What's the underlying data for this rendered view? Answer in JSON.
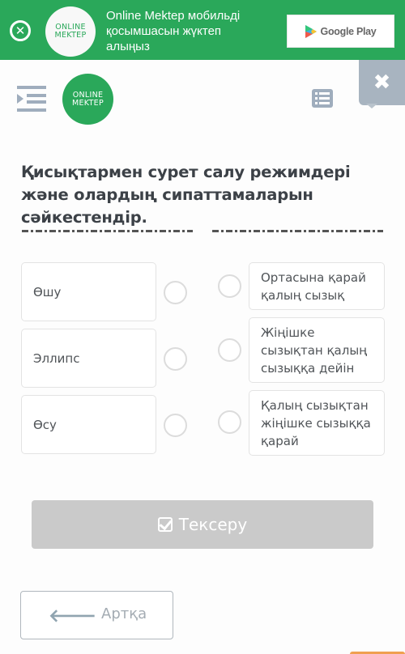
{
  "banner": {
    "close_icon": "circle-x-icon",
    "logo": {
      "line1": "ONLINE",
      "line2": "MEKTEP"
    },
    "message": "Online Mektep мобильді қосымшасын жүктеп алыңыз",
    "store_button": {
      "label": "Google Play",
      "icon": "google-play-icon"
    }
  },
  "header": {
    "menu_icon": "sidebar-toggle-icon",
    "logo": {
      "line1": "ONLINE",
      "line2": "MEKTEP"
    },
    "list_icon": "list-icon",
    "close_icon": "close-icon"
  },
  "task": {
    "title": "Қисықтармен сурет салу режимдері және олардың сипаттамаларын сәйкестендір."
  },
  "matching": {
    "left": [
      {
        "label": "Өшу"
      },
      {
        "label": "Эллипс"
      },
      {
        "label": "Өсу"
      }
    ],
    "right": [
      {
        "label": "Ортасына қарай қалың сызық"
      },
      {
        "label": "Жіңішке сызықтан қалың сызыққа дейін"
      },
      {
        "label": "Қалың сызықтан жіңішке сызыққа қарай"
      }
    ]
  },
  "actions": {
    "check_label": "Тексеру",
    "check_icon": "checkbox-icon",
    "back_label": "Артқа",
    "back_icon": "arrow-left-icon"
  },
  "colors": {
    "brand_green": "#2aa85a",
    "disabled_button": "#cacaca",
    "icon_gray": "#9fadbd"
  }
}
